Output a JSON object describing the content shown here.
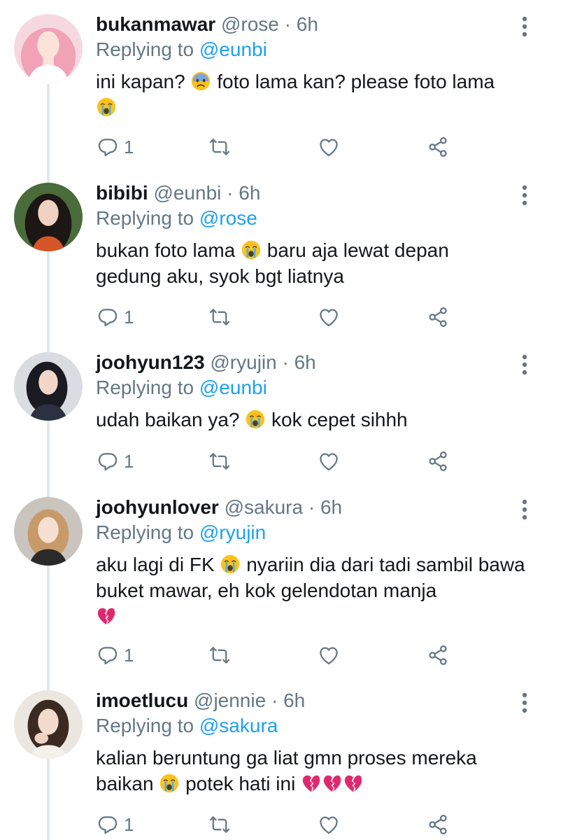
{
  "tweets": [
    {
      "name": "bukanmawar",
      "handle": "@rose",
      "dot": "·",
      "time": "6h",
      "replying_prefix": "Replying to ",
      "replying_to": "@eunbi",
      "text_1": "ini kapan? ",
      "emoji_1": "fearful-face",
      "text_2": " foto lama kan? please foto lama",
      "emoji_2": "crying-face",
      "replies": "1"
    },
    {
      "name": "bibibi",
      "handle": "@eunbi",
      "dot": "·",
      "time": "6h",
      "replying_prefix": "Replying to ",
      "replying_to": "@rose",
      "text_1": "bukan foto lama ",
      "emoji_1": "crying-face",
      "text_2": " baru aja lewat depan gedung aku, syok bgt liatnya",
      "replies": "1"
    },
    {
      "name": "joohyun123",
      "handle": "@ryujin",
      "dot": "·",
      "time": "6h",
      "replying_prefix": "Replying to ",
      "replying_to": "@eunbi",
      "text_1": "udah baikan ya? ",
      "emoji_1": "crying-face",
      "text_2": " kok cepet sihhh",
      "replies": "1"
    },
    {
      "name": "joohyunlover",
      "handle": "@sakura",
      "dot": "·",
      "time": "6h",
      "replying_prefix": "Replying to ",
      "replying_to": "@ryujin",
      "text_1": "aku lagi di FK ",
      "emoji_1": "crying-face",
      "text_2": " nyariin dia dari tadi sambil bawa buket mawar, eh kok gelendotan manja",
      "emoji_2": "broken-heart",
      "replies": "1"
    },
    {
      "name": "imoetlucu",
      "handle": "@jennie",
      "dot": "·",
      "time": "6h",
      "replying_prefix": "Replying to ",
      "replying_to": "@sakura",
      "text_1": "kalian beruntung ga liat gmn proses mereka baikan ",
      "emoji_1": "crying-face",
      "text_2": " potek hati ini ",
      "emoji_2": "broken-heart",
      "replies": "1"
    }
  ],
  "colors": {
    "name": "#14171a",
    "meta": "#657786",
    "mention": "#1da1f2",
    "thread_line": "#e1e8ed"
  },
  "icons": [
    "reply-icon",
    "retweet-icon",
    "like-icon",
    "share-icon",
    "more-icon"
  ]
}
